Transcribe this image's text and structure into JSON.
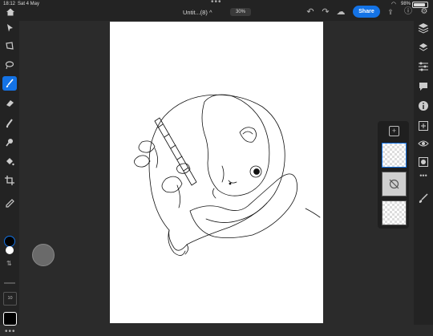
{
  "status": {
    "time": "18:12",
    "date": "Sat 4 May",
    "battery": "98%"
  },
  "document": {
    "title": "Untit...(8)",
    "title_chevron": "^",
    "zoom": "30%"
  },
  "toolbar": {
    "share_label": "Share"
  },
  "left_tools": [
    "select-tool",
    "transform-tool",
    "lasso-tool",
    "brush-tool",
    "eraser-tool",
    "smudge-tool",
    "clone-tool",
    "fill-tool",
    "crop-tool",
    "eyedropper-tool"
  ],
  "brush": {
    "size": "10"
  },
  "colors": {
    "foreground": "#000000",
    "background": "#ffffff",
    "accent": "#1473e6"
  },
  "right_tools": [
    "layers-icon",
    "layer-stack-icon",
    "adjustments-icon",
    "comments-icon",
    "info-icon",
    "add-layer-icon",
    "visibility-icon",
    "mask-icon",
    "more-icon",
    "brush-panel-icon"
  ],
  "layers": {
    "count": 3,
    "selected": 0
  }
}
